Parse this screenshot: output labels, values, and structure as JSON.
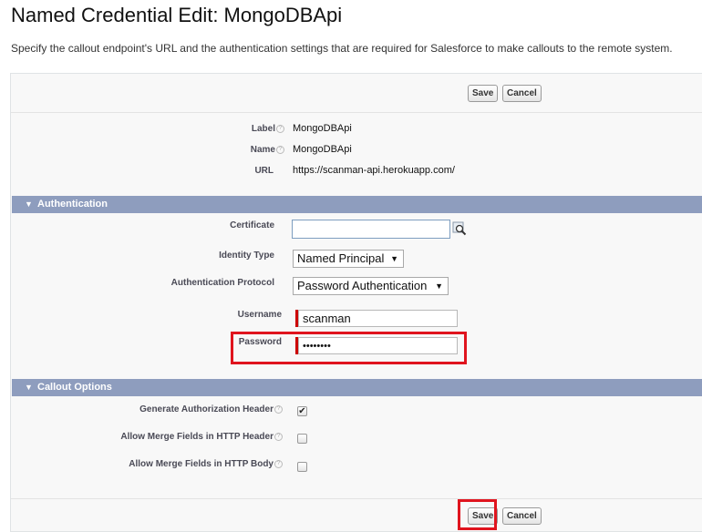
{
  "page": {
    "title": "Named Credential Edit: MongoDBApi",
    "description": "Specify the callout endpoint's URL and the authentication settings that are required for Salesforce to make callouts to the remote system."
  },
  "buttons": {
    "save": "Save",
    "cancel": "Cancel"
  },
  "info": {
    "label_label": "Label",
    "label_value": "MongoDBApi",
    "name_label": "Name",
    "name_value": "MongoDBApi",
    "url_label": "URL",
    "url_value": "https://scanman-api.herokuapp.com/"
  },
  "authentication": {
    "section_title": "Authentication",
    "certificate_label": "Certificate",
    "certificate_value": "",
    "identity_type_label": "Identity Type",
    "identity_type_value": "Named Principal",
    "protocol_label": "Authentication Protocol",
    "protocol_value": "Password Authentication",
    "username_label": "Username",
    "username_value": "scanman",
    "password_label": "Password",
    "password_value": "••••••••"
  },
  "callout": {
    "section_title": "Callout Options",
    "gen_auth_label": "Generate Authorization Header",
    "gen_auth_checked": true,
    "merge_header_label": "Allow Merge Fields in HTTP Header",
    "merge_header_checked": false,
    "merge_body_label": "Allow Merge Fields in HTTP Body",
    "merge_body_checked": false
  },
  "icons": {
    "help": "help-icon",
    "lookup": "lookup-icon",
    "dropdown": "dropdown-arrow-icon",
    "collapse": "collapse-triangle-icon"
  },
  "colors": {
    "section_header": "#8e9dbe",
    "highlight": "#e0141e",
    "required": "#cc0000"
  }
}
